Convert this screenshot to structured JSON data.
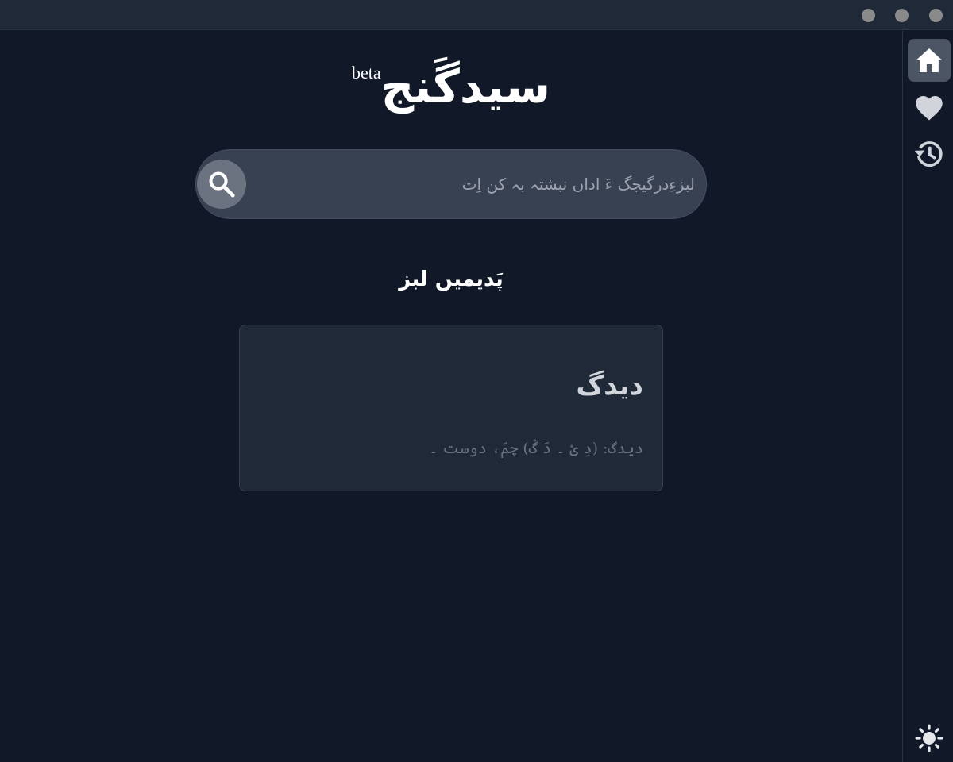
{
  "window": {
    "controls": [
      "dot",
      "dot",
      "dot"
    ]
  },
  "app": {
    "logo": "سیدگَنج",
    "logo_badge": "beta"
  },
  "search": {
    "placeholder": "لبزءِدرگیجگ ءَ اداں نبشتہ بہ کن اِت",
    "value": "",
    "icon": "search-icon"
  },
  "section": {
    "title": "پَدیمیں لبز"
  },
  "recent_words": [
    {
      "word": "دیدگ",
      "snippet": "دیدگ: (دِ یْ ۔ دَ گْ) چمّ، دوست ۔"
    }
  ],
  "sidebar": {
    "items": [
      {
        "name": "home",
        "icon": "home-icon",
        "active": true
      },
      {
        "name": "favorites",
        "icon": "heart-icon",
        "active": false
      },
      {
        "name": "history",
        "icon": "history-icon",
        "active": false
      }
    ],
    "theme_toggle": {
      "icon": "sun-icon"
    }
  },
  "colors": {
    "background": "#111827",
    "surface": "#1f2937",
    "search_bg": "#374151",
    "active": "#4b5563",
    "text": "#ffffff"
  }
}
